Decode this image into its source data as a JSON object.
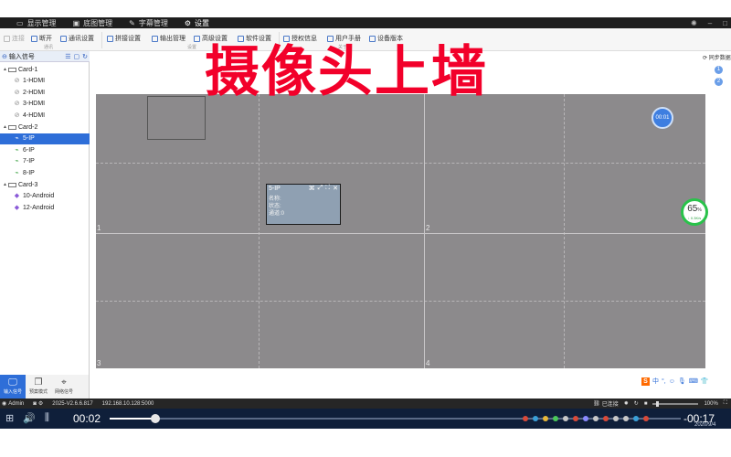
{
  "tabs": [
    {
      "label": "显示管理",
      "icon": "display-icon"
    },
    {
      "label": "底图管理",
      "icon": "image-icon"
    },
    {
      "label": "字幕管理",
      "icon": "subtitle-icon"
    },
    {
      "label": "设置",
      "icon": "gear-icon"
    }
  ],
  "ribbon": {
    "connect": "连接",
    "disconnect": "断开",
    "comm_settings": "通讯设置",
    "group_comm": "通讯",
    "splice_settings": "拼接设置",
    "output_mgmt": "输出管理",
    "advanced": "高级设置",
    "software": "软件设置",
    "group_settings": "设置",
    "license": "授权信息",
    "manual": "用户手册",
    "version": "设备版本",
    "group_about": "关于"
  },
  "left_panel": {
    "header": "输入信号",
    "tree": [
      {
        "label": "Card-1",
        "level": 0
      },
      {
        "label": "1-HDMI",
        "level": 1,
        "icon": "hdmi-icon"
      },
      {
        "label": "2-HDMI",
        "level": 1,
        "icon": "hdmi-icon"
      },
      {
        "label": "3-HDMI",
        "level": 1,
        "icon": "hdmi-icon"
      },
      {
        "label": "4-HDMI",
        "level": 1,
        "icon": "hdmi-icon"
      },
      {
        "label": "Card-2",
        "level": 0
      },
      {
        "label": "5-IP",
        "level": 1,
        "icon": "camera-icon",
        "selected": true
      },
      {
        "label": "6-IP",
        "level": 1,
        "icon": "camera-icon"
      },
      {
        "label": "7-IP",
        "level": 1,
        "icon": "camera-icon"
      },
      {
        "label": "8-IP",
        "level": 1,
        "icon": "camera-icon"
      },
      {
        "label": "Card-3",
        "level": 0
      },
      {
        "label": "10-Android",
        "level": 1,
        "icon": "android-icon"
      },
      {
        "label": "12-Android",
        "level": 1,
        "icon": "android-icon"
      }
    ],
    "bottom_tabs": [
      "输入信号",
      "预案模式",
      "网络信号"
    ]
  },
  "overlay_title": "摄像头上墙",
  "canvas": {
    "screens": [
      "1",
      "2",
      "3",
      "4"
    ],
    "window": {
      "title": "5-IP",
      "name_label": "名称:",
      "status_label": "状态:",
      "channel_label": "通道:0"
    },
    "timer": "00:01"
  },
  "right": {
    "sync_label": "同步数据",
    "pages": [
      "1",
      "2"
    ]
  },
  "gauge": {
    "percent": "65",
    "unit": "%",
    "speed": "↓ 0.3K/s"
  },
  "ime": {
    "logo": "S",
    "lang": "中"
  },
  "statusbar": {
    "user": "Admin",
    "version": "2025-V2.6.6.817",
    "ip": "192.168.10.128:5000",
    "connected": "已连接",
    "zoom": "100%"
  },
  "player": {
    "current": "00:02",
    "remaining": "-00:17",
    "progress": 0.08,
    "date": "2020/9/4"
  },
  "colors": {
    "accent": "#2e6ed8",
    "overlay": "#f2002a",
    "canvas": "#8c8a8c"
  }
}
